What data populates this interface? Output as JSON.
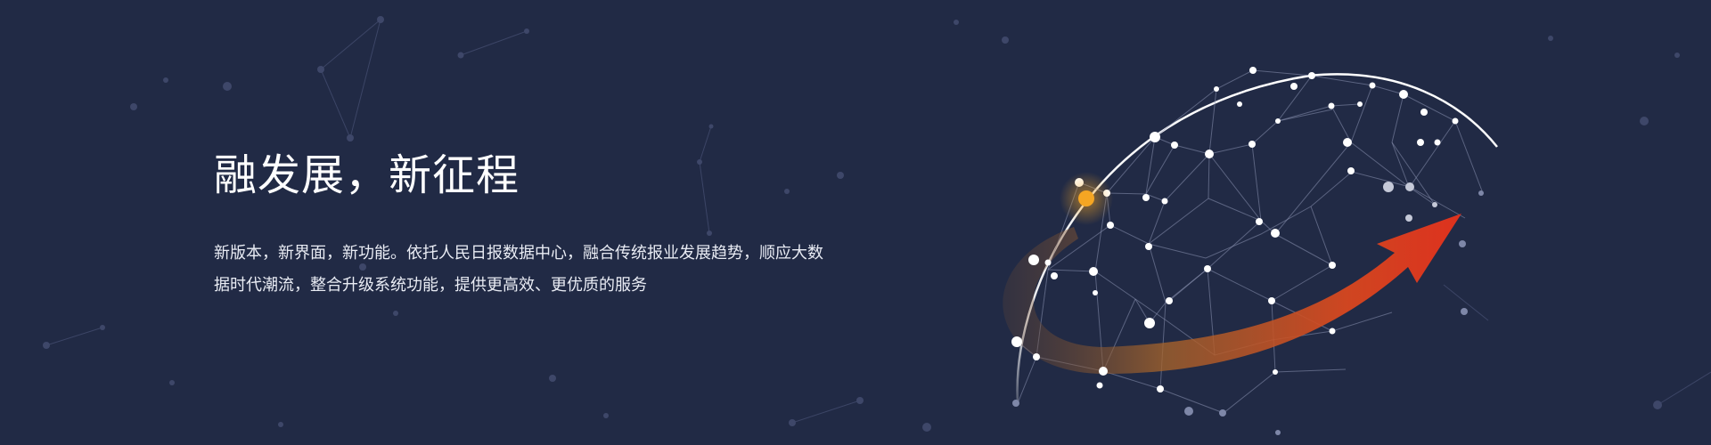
{
  "banner": {
    "headline": "融发展，新征程",
    "description": "新版本，新界面，新功能。依托人民日报数据中心，融合传统报业发展趋势，顺应大数据时代潮流，整合升级系统功能，提供更高效、更优质的服务"
  },
  "colors": {
    "background": "#212a45",
    "network_line": "#7e87a8",
    "node_white": "#ffffff",
    "highlight_node": "#f5a623",
    "arrow_start": "#8a5a2a",
    "arrow_end": "#e8321c"
  },
  "icons": [
    "network-globe-icon",
    "growth-arrow-icon"
  ]
}
